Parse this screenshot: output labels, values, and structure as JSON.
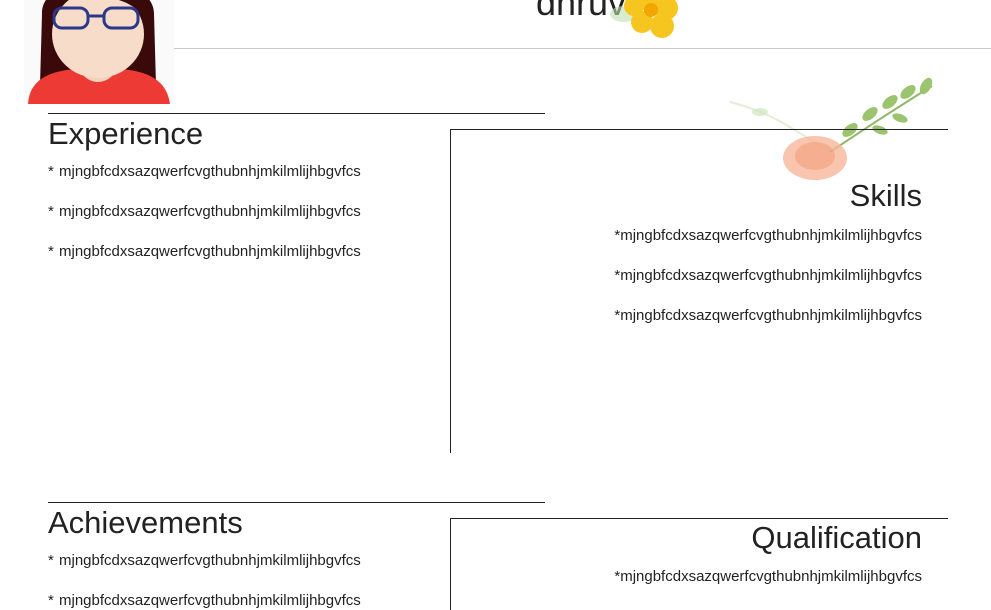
{
  "profile": {
    "name": "dhruv"
  },
  "sections": {
    "experience": {
      "title": "Experience",
      "items": [
        "mjngbfcdxsazqwerfcvgthubnhjmkilmlijhbgvfcs",
        "mjngbfcdxsazqwerfcvgthubnhjmkilmlijhbgvfcs",
        "mjngbfcdxsazqwerfcvgthubnhjmkilmlijhbgvfcs"
      ]
    },
    "skills": {
      "title": "Skills",
      "items": [
        "mjngbfcdxsazqwerfcvgthubnhjmkilmlijhbgvfcs",
        "mjngbfcdxsazqwerfcvgthubnhjmkilmlijhbgvfcs",
        "mjngbfcdxsazqwerfcvgthubnhjmkilmlijhbgvfcs"
      ]
    },
    "achievements": {
      "title": "Achievements",
      "items": [
        "mjngbfcdxsazqwerfcvgthubnhjmkilmlijhbgvfcs",
        "mjngbfcdxsazqwerfcvgthubnhjmkilmlijhbgvfcs"
      ]
    },
    "qualification": {
      "title": "Qualification",
      "items": [
        "mjngbfcdxsazqwerfcvgthubnhjmkilmlijhbgvfcs"
      ]
    }
  },
  "bullet": "*",
  "icons": {
    "avatar": "avatar-girl-with-glasses",
    "flower_top": "yellow-flower-decoration",
    "flower_right": "peach-flower-branch-decoration"
  },
  "colors": {
    "avatar_shirt": "#ee3a35",
    "avatar_hair": "#3a0a0a",
    "glasses": "#2a3a8a",
    "flower": "#f7c520"
  }
}
